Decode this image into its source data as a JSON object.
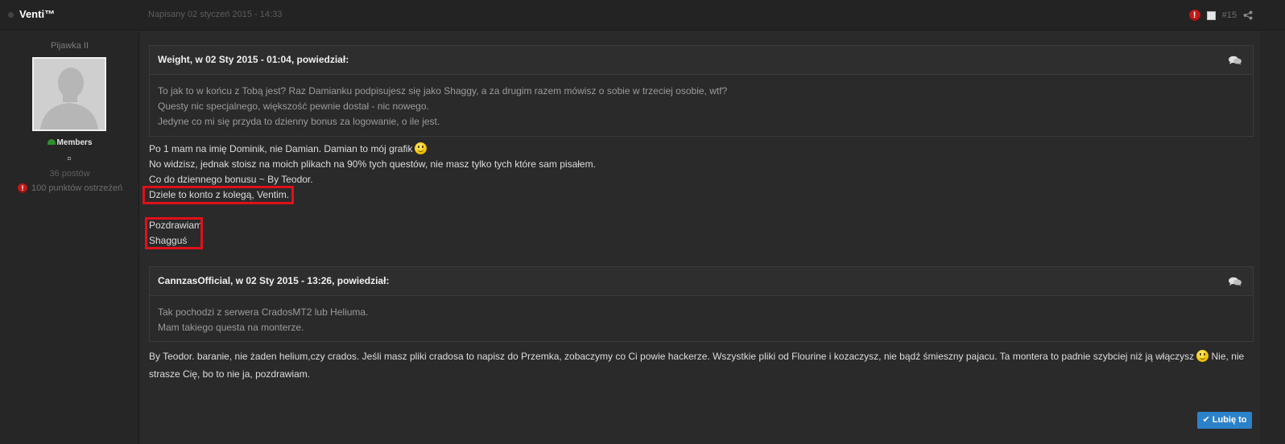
{
  "header": {
    "author": "Venti™",
    "date": "Napisany 02 styczeń 2015 - 14:33",
    "post_number": "#15",
    "warn_glyph": "!"
  },
  "profile": {
    "rank": "Pijawka II",
    "group": "Members",
    "post_count": "36 postów",
    "warning_points": "100 punktów ostrzeżeń",
    "warn_glyph": "!"
  },
  "quote1": {
    "header": "Weight, w 02 Sty 2015 - 01:04, powiedział:",
    "lines": [
      "To jak to w końcu z Tobą jest? Raz Damianku podpisujesz się jako Shaggy, a za drugim razem mówisz o sobie w trzeciej osobie, wtf?",
      "Questy nic specjalnego, większość pewnie dostał - nic nowego.",
      "Jedyne co mi się przyda to dzienny bonus za logowanie, o ile jest."
    ]
  },
  "reply1": {
    "lines": [
      "Po 1 mam na imię Dominik, nie Damian. Damian to mój grafik",
      "No widzisz, jednak stoisz na moich plikach na 90% tych questów, nie masz tylko tych które sam pisałem.",
      "Co do dziennego bonusu ~ By Teodor.",
      "Dziele to konto z kolegą, Ventim.",
      "",
      "Pozdrawiam",
      "Shagguś"
    ]
  },
  "quote2": {
    "header": "CannzasOfficial, w 02 Sty 2015 - 13:26, powiedział:",
    "lines": [
      "Tak pochodzi z serwera CradosMT2 lub Heliuma.",
      "Mam takiego questa na monterze."
    ]
  },
  "reply2": {
    "line1a": "By Teodor. baranie, nie żaden helium,czy crados. Jeśli masz pliki cradosa to napisz do Przemka, zobaczymy co Ci powie hackerze. Wszystkie pliki od Flourine i kozaczysz, nie bądź śmieszny pajacu. Ta montera to padnie szybciej niż ją włączysz",
    "line1b": "Nie, nie",
    "line2": "strasze Cię, bo to nie ja, pozdrawiam."
  },
  "like_button": {
    "label": "✔ Lubię to",
    "color": "#2c82c9"
  },
  "highlight_color": "#e0101a"
}
